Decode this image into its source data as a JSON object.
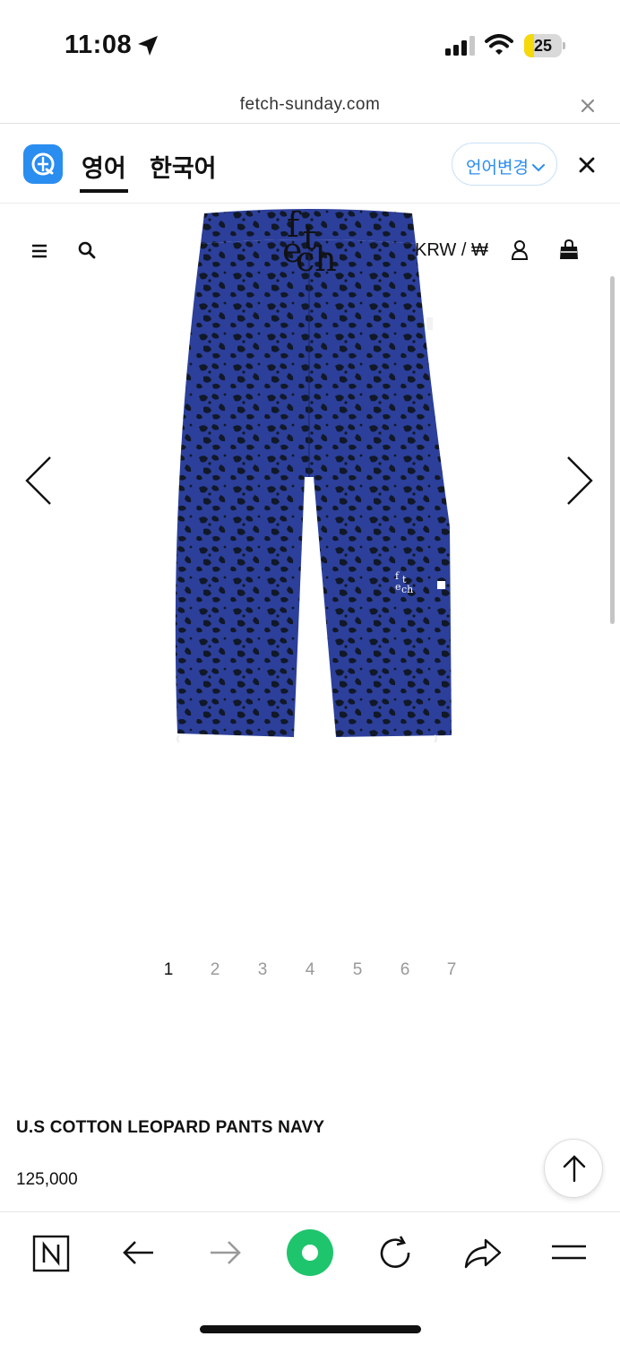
{
  "status_bar": {
    "time": "11:08",
    "battery_level": 25,
    "battery_color": "#f5d90a",
    "icons": [
      "location-arrow-icon",
      "signal-icon",
      "wifi-icon",
      "battery-icon"
    ]
  },
  "url_bar": {
    "domain": "fetch-sunday.com"
  },
  "translate_bar": {
    "tab_english": "영어",
    "tab_korean": "한국어",
    "active_tab": "영어",
    "change_language": "언어변경",
    "accent_color": "#2a8df0"
  },
  "site_header": {
    "brand_letters": [
      "f",
      "t",
      "e",
      "ch"
    ],
    "currency": "KRW / ₩"
  },
  "product_image": {
    "logo_letters": [
      "f",
      "t",
      "e",
      "ch"
    ]
  },
  "pagination": {
    "pages": [
      "1",
      "2",
      "3",
      "4",
      "5",
      "6",
      "7"
    ],
    "active": "1"
  },
  "product": {
    "title": "U.S COTTON LEOPARD PANTS NAVY",
    "price": "125,000"
  },
  "bottom_toolbar": {
    "items": [
      "naver-icon",
      "back-arrow-icon",
      "forward-arrow-icon",
      "green-dot-icon",
      "refresh-icon",
      "share-icon",
      "menu-icon"
    ],
    "accent_color": "#1ec56c"
  }
}
